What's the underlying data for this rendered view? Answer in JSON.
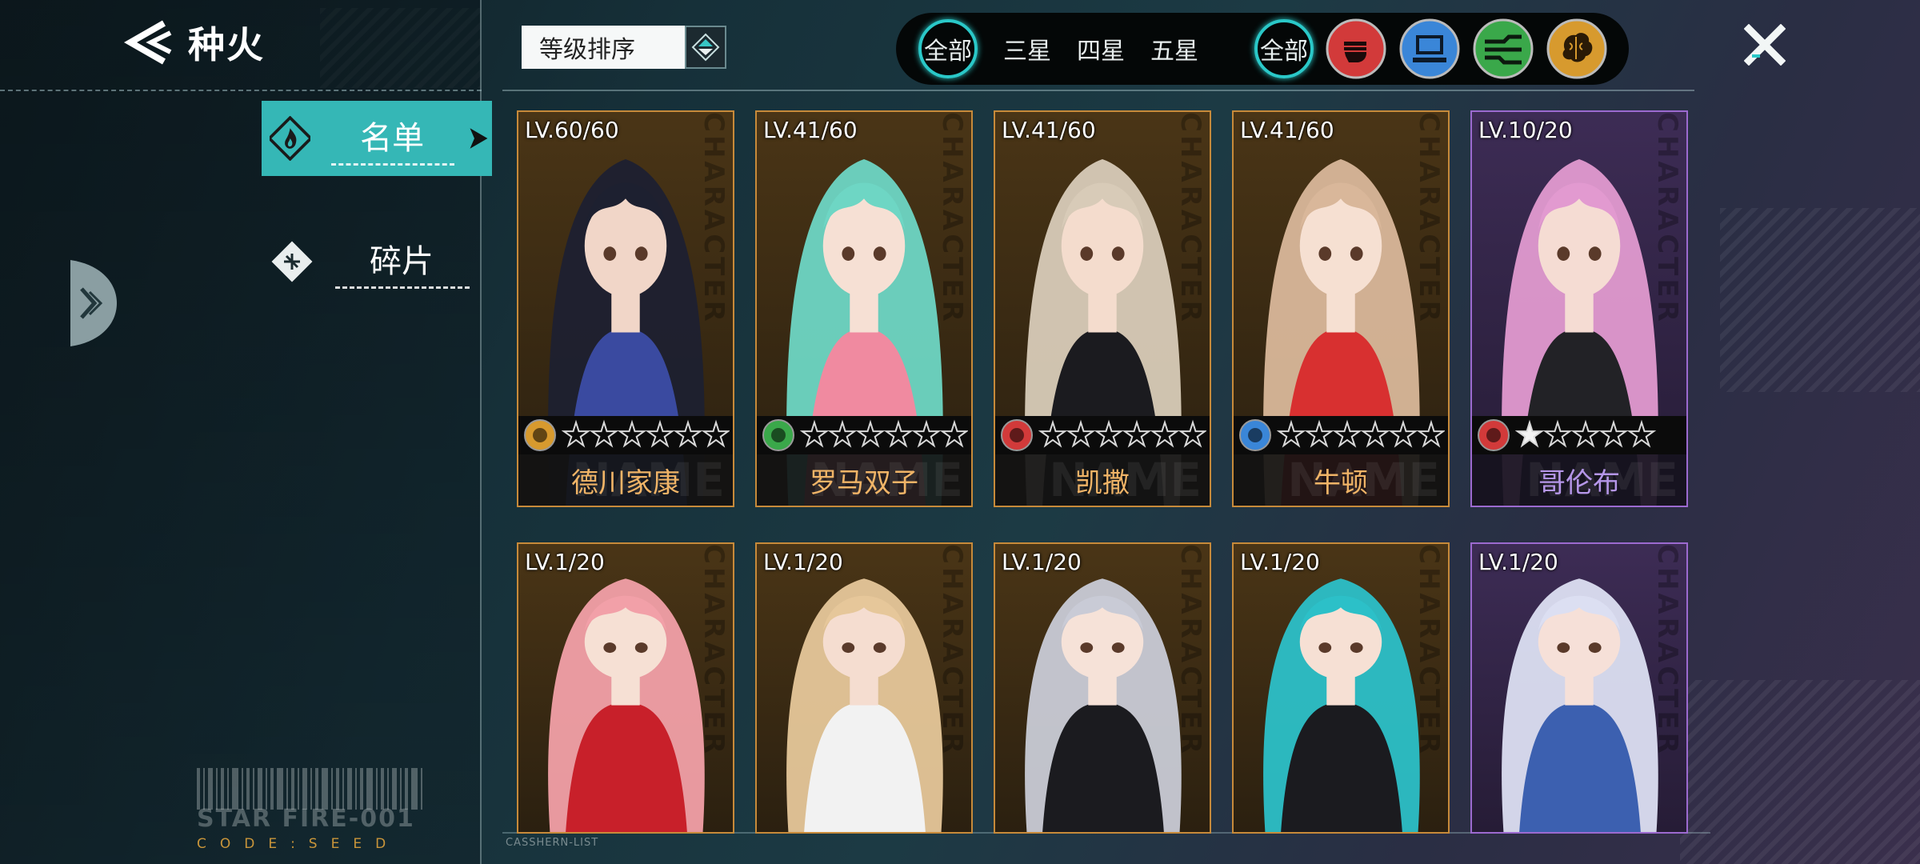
{
  "header": {
    "title": "种火"
  },
  "sidebar": {
    "items": [
      {
        "label": "名单",
        "active": true
      },
      {
        "label": "碎片",
        "active": false
      }
    ],
    "barcode_title": "STAR FIRE-001",
    "barcode_code": "CODE:SEED"
  },
  "sort": {
    "label": "等级排序"
  },
  "filters": {
    "stars": [
      "全部",
      "三星",
      "四星",
      "五星"
    ],
    "types_all": "全部",
    "types": [
      {
        "icon": "fist-icon",
        "color": "#d23a3a"
      },
      {
        "icon": "computer-icon",
        "color": "#3a86d8"
      },
      {
        "icon": "circuit-icon",
        "color": "#3aa84a"
      },
      {
        "icon": "brain-icon",
        "color": "#d79a2e"
      }
    ]
  },
  "footer": {
    "list_label": "CASSHERN-LIST"
  },
  "cards": [
    {
      "lv": "LV.60/60",
      "name": "德川家康",
      "type": "brain-icon",
      "stars_filled": 0,
      "stars_total": 6,
      "rarity": "gold",
      "hair": "#1d2030",
      "accent": "#3a4aa0",
      "skin": "#f1d6c8"
    },
    {
      "lv": "LV.41/60",
      "name": "罗马双子",
      "type": "circuit-icon",
      "stars_filled": 0,
      "stars_total": 6,
      "rarity": "gold",
      "hair": "#6ed6c4",
      "accent": "#f08aa0",
      "skin": "#f6e0d4"
    },
    {
      "lv": "LV.41/60",
      "name": "凯撒",
      "type": "fist-icon",
      "stars_filled": 0,
      "stars_total": 6,
      "rarity": "gold",
      "hair": "#d8cbb8",
      "accent": "#1b1b1f",
      "skin": "#f4dccd"
    },
    {
      "lv": "LV.41/60",
      "name": "牛顿",
      "type": "computer-icon",
      "stars_filled": 0,
      "stars_total": 6,
      "rarity": "gold",
      "hair": "#d9b79a",
      "accent": "#d83030",
      "skin": "#f6e0d2"
    },
    {
      "lv": "LV.10/20",
      "name": "哥伦布",
      "type": "fist-icon",
      "stars_filled": 1,
      "stars_total": 5,
      "rarity": "purple",
      "hair": "#e29ad0",
      "accent": "#222226",
      "skin": "#f5dcd3"
    },
    {
      "lv": "LV.1/20",
      "name": "",
      "type": "",
      "stars_filled": 0,
      "stars_total": 0,
      "rarity": "gold",
      "hair": "#f2a0a8",
      "accent": "#c8202a",
      "skin": "#f6e0d4"
    },
    {
      "lv": "LV.1/20",
      "name": "",
      "type": "",
      "stars_filled": 0,
      "stars_total": 0,
      "rarity": "gold",
      "hair": "#e6c79a",
      "accent": "#f2f2f2",
      "skin": "#f5ddd0"
    },
    {
      "lv": "LV.1/20",
      "name": "",
      "type": "",
      "stars_filled": 0,
      "stars_total": 0,
      "rarity": "gold",
      "hair": "#c9cbd6",
      "accent": "#1b1b1f",
      "skin": "#f6e2d8"
    },
    {
      "lv": "LV.1/20",
      "name": "",
      "type": "",
      "stars_filled": 0,
      "stars_total": 0,
      "rarity": "gold",
      "hair": "#2cc0c8",
      "accent": "#1b1b1f",
      "skin": "#f6e0d4"
    },
    {
      "lv": "LV.1/20",
      "name": "",
      "type": "",
      "stars_filled": 0,
      "stars_total": 0,
      "rarity": "purple",
      "hair": "#dcdff2",
      "accent": "#3c60b0",
      "skin": "#f6e0d8"
    }
  ],
  "card_side_text": "CHARACTER",
  "card_name_bg": "NAME"
}
